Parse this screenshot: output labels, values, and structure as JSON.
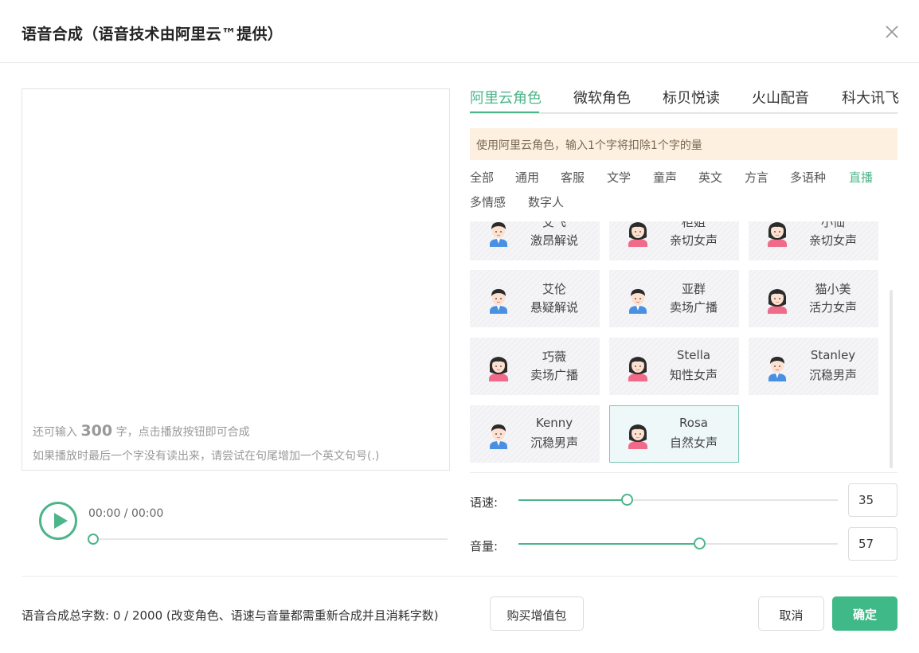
{
  "dialog": {
    "title": "语音合成（语音技术由阿里云™提供）"
  },
  "editor": {
    "hint_prefix": "还可输入",
    "remaining": "300",
    "hint_suffix": "字，点击播放按钮即可合成",
    "hint2": "如果播放时最后一个字没有读出来，请尝试在句尾增加一个英文句号(.)"
  },
  "player": {
    "time": "00:00 / 00:00",
    "progress": 0
  },
  "tabs": [
    {
      "label": "阿里云角色",
      "active": true
    },
    {
      "label": "微软角色",
      "active": false
    },
    {
      "label": "标贝悦读",
      "active": false
    },
    {
      "label": "火山配音",
      "active": false
    },
    {
      "label": "科大讯飞",
      "active": false
    }
  ],
  "notice": "使用阿里云角色，输入1个字将扣除1个字的量",
  "categories": [
    {
      "label": "全部",
      "active": false
    },
    {
      "label": "通用",
      "active": false
    },
    {
      "label": "客服",
      "active": false
    },
    {
      "label": "文学",
      "active": false
    },
    {
      "label": "童声",
      "active": false
    },
    {
      "label": "英文",
      "active": false
    },
    {
      "label": "方言",
      "active": false
    },
    {
      "label": "多语种",
      "active": false
    },
    {
      "label": "直播",
      "active": true
    },
    {
      "label": "多情感",
      "active": false
    },
    {
      "label": "数字人",
      "active": false
    }
  ],
  "voices": [
    {
      "name": "艾飞",
      "desc": "激昂解说",
      "gender": "male",
      "selected": false
    },
    {
      "name": "柜姐",
      "desc": "亲切女声",
      "gender": "female",
      "selected": false
    },
    {
      "name": "小仙",
      "desc": "亲切女声",
      "gender": "female",
      "selected": false
    },
    {
      "name": "艾伦",
      "desc": "悬疑解说",
      "gender": "male",
      "selected": false
    },
    {
      "name": "亚群",
      "desc": "卖场广播",
      "gender": "male",
      "selected": false
    },
    {
      "name": "猫小美",
      "desc": "活力女声",
      "gender": "female",
      "selected": false
    },
    {
      "name": "巧薇",
      "desc": "卖场广播",
      "gender": "female",
      "selected": false
    },
    {
      "name": "Stella",
      "desc": "知性女声",
      "gender": "female",
      "selected": false
    },
    {
      "name": "Stanley",
      "desc": "沉稳男声",
      "gender": "male",
      "selected": false
    },
    {
      "name": "Kenny",
      "desc": "沉稳男声",
      "gender": "male",
      "selected": false
    },
    {
      "name": "Rosa",
      "desc": "自然女声",
      "gender": "female",
      "selected": true
    }
  ],
  "speed": {
    "label": "语速:",
    "value": "35",
    "level": 0.34
  },
  "volume": {
    "label": "音量:",
    "value": "57",
    "level": 0.565
  },
  "footer": {
    "summary": "语音合成总字数:  0 / 2000  (改变角色、语速与音量都需重新合成并且消耗字数)",
    "buy_label": "购买增值包",
    "cancel_label": "取消",
    "ok_label": "确定"
  },
  "colors": {
    "accent": "#4db58a",
    "primary_button": "#3fb987",
    "notice_bg": "#fdf0e0"
  }
}
